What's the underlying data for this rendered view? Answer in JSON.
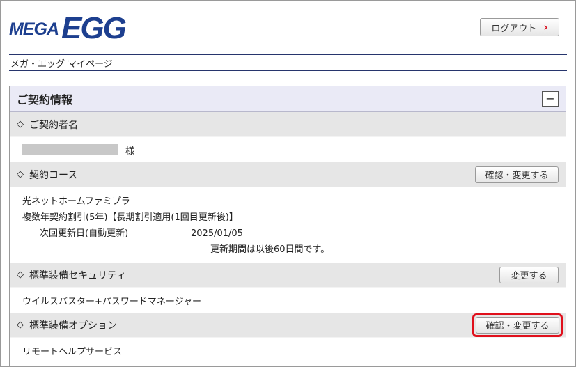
{
  "header": {
    "logo_part1": "MEGA",
    "logo_part2": "EGG",
    "logout_label": "ログアウト",
    "page_name": "メガ・エッグ マイページ"
  },
  "panel": {
    "title": "ご契約情報",
    "collapse_symbol": "−",
    "sections": {
      "contractor": {
        "label": "ご契約者名",
        "suffix": "様"
      },
      "course": {
        "label": "契約コース",
        "button": "確認・変更する",
        "plan": "光ネットホームファミプラ",
        "discount": "複数年契約割引(5年)【長期割引適用(1回目更新後)】",
        "renewal_label": "次回更新日(自動更新)",
        "renewal_date": "2025/01/05",
        "renewal_note": "更新期間は以後60日間です。"
      },
      "security": {
        "label": "標準装備セキュリティ",
        "button": "変更する",
        "value": "ウイルスバスター+パスワードマネージャー"
      },
      "option": {
        "label": "標準装備オプション",
        "button": "確認・変更する",
        "value": "リモートヘルプサービス"
      }
    }
  },
  "glyphs": {
    "diamond": "◇",
    "chevron": "›"
  },
  "colors": {
    "brand": "#1d3f8f",
    "accent": "#d8101f",
    "highlight": "#e0101c",
    "header_bg": "#eaeaf6",
    "section_bg": "#e6e6e6"
  }
}
